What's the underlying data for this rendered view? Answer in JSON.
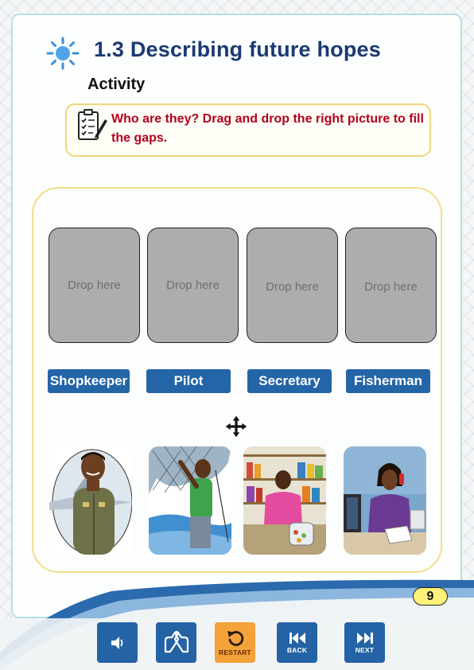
{
  "header": {
    "title": "1.3 Describing future hopes",
    "section": "Activity"
  },
  "instruction": {
    "text": "Who are they? Drag and drop the right picture to fill the gaps."
  },
  "drop_zones": [
    {
      "placeholder": "Drop here"
    },
    {
      "placeholder": "Drop here"
    },
    {
      "placeholder": "Drop here"
    },
    {
      "placeholder": "Drop here"
    }
  ],
  "labels": [
    "Shopkeeper",
    "Pilot",
    "Secretary",
    "Fisherman"
  ],
  "pictures": [
    {
      "icon": "pilot-picture"
    },
    {
      "icon": "fisherman-picture"
    },
    {
      "icon": "shopkeeper-picture"
    },
    {
      "icon": "secretary-picture"
    }
  ],
  "page_number": "9",
  "toolbar": {
    "audio": {
      "icon": "speaker-icon"
    },
    "sign_language": {
      "icon": "sign-language-icon"
    },
    "restart": {
      "icon": "restart-icon",
      "label": "RESTART"
    },
    "back": {
      "icon": "back-icon",
      "label": "BACK"
    },
    "next": {
      "icon": "next-icon",
      "label": "NEXT"
    }
  },
  "colors": {
    "title": "#1b3a72",
    "instruction": "#b3001e",
    "label_button": "#2465a8",
    "toolbar_button": "#2463a5",
    "restart_button": "#f4a23a",
    "page_badge": "#fff27a"
  }
}
